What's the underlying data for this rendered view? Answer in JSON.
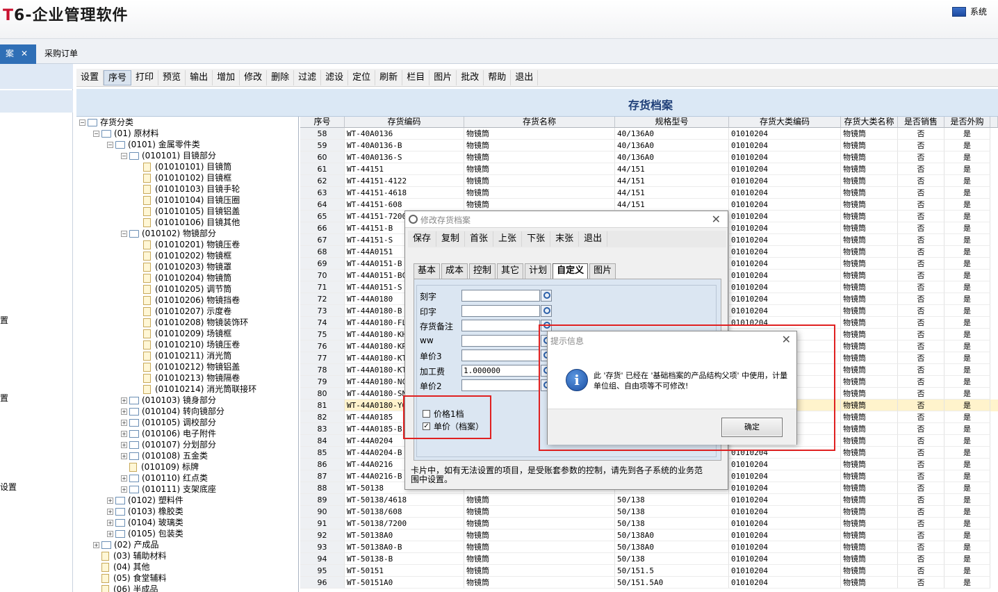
{
  "app": {
    "logo_t": "T",
    "logo_rest": "6-企业管理软件",
    "system_label": "系统"
  },
  "tabs": [
    {
      "label": "案",
      "close": "✕",
      "active": true
    },
    {
      "label": "采购订单",
      "active": false
    }
  ],
  "left_strip": [
    "置",
    "置",
    "设置"
  ],
  "toolbar": [
    "设置",
    "序号",
    "打印",
    "预览",
    "输出",
    "增加",
    "修改",
    "删除",
    "过滤",
    "滤设",
    "定位",
    "刷新",
    "栏目",
    "图片",
    "批改",
    "帮助",
    "退出"
  ],
  "toolbar_pressed": "序号",
  "page_title": "存货档案",
  "tree": [
    {
      "depth": 0,
      "exp": "−",
      "icon": "folder",
      "label": "存货分类"
    },
    {
      "depth": 1,
      "exp": "−",
      "icon": "folder",
      "label": "(01) 原材料"
    },
    {
      "depth": 2,
      "exp": "−",
      "icon": "folder",
      "label": "(0101) 金属零件类"
    },
    {
      "depth": 3,
      "exp": "−",
      "icon": "folder",
      "label": "(010101) 目镜部分"
    },
    {
      "depth": 4,
      "exp": "",
      "icon": "doc",
      "label": "(01010101) 目镜筒"
    },
    {
      "depth": 4,
      "exp": "",
      "icon": "doc",
      "label": "(01010102) 目镜框"
    },
    {
      "depth": 4,
      "exp": "",
      "icon": "doc",
      "label": "(01010103) 目镜手轮"
    },
    {
      "depth": 4,
      "exp": "",
      "icon": "doc",
      "label": "(01010104) 目镜压圈"
    },
    {
      "depth": 4,
      "exp": "",
      "icon": "doc",
      "label": "(01010105) 目镜铝盖"
    },
    {
      "depth": 4,
      "exp": "",
      "icon": "doc",
      "label": "(01010106) 目镜其他"
    },
    {
      "depth": 3,
      "exp": "−",
      "icon": "folder",
      "label": "(010102) 物镜部分"
    },
    {
      "depth": 4,
      "exp": "",
      "icon": "doc",
      "label": "(01010201) 物镜压卷"
    },
    {
      "depth": 4,
      "exp": "",
      "icon": "doc",
      "label": "(01010202) 物镜框"
    },
    {
      "depth": 4,
      "exp": "",
      "icon": "doc",
      "label": "(01010203) 物镜罩"
    },
    {
      "depth": 4,
      "exp": "",
      "icon": "doc",
      "label": "(01010204) 物镜筒"
    },
    {
      "depth": 4,
      "exp": "",
      "icon": "doc",
      "label": "(01010205) 调节筒"
    },
    {
      "depth": 4,
      "exp": "",
      "icon": "doc",
      "label": "(01010206) 物镜挡卷"
    },
    {
      "depth": 4,
      "exp": "",
      "icon": "doc",
      "label": "(01010207) 示度卷"
    },
    {
      "depth": 4,
      "exp": "",
      "icon": "doc",
      "label": "(01010208) 物镜装饰环"
    },
    {
      "depth": 4,
      "exp": "",
      "icon": "doc",
      "label": "(01010209) 场镜框"
    },
    {
      "depth": 4,
      "exp": "",
      "icon": "doc",
      "label": "(01010210) 场镜压卷"
    },
    {
      "depth": 4,
      "exp": "",
      "icon": "doc",
      "label": "(01010211) 消光筒"
    },
    {
      "depth": 4,
      "exp": "",
      "icon": "doc",
      "label": "(01010212) 物镜铝盖"
    },
    {
      "depth": 4,
      "exp": "",
      "icon": "doc",
      "label": "(01010213) 物镜隔卷"
    },
    {
      "depth": 4,
      "exp": "",
      "icon": "doc",
      "label": "(01010214) 消光筒联接环"
    },
    {
      "depth": 3,
      "exp": "+",
      "icon": "folder",
      "label": "(010103) 镜身部分"
    },
    {
      "depth": 3,
      "exp": "+",
      "icon": "folder",
      "label": "(010104) 转向镜部分"
    },
    {
      "depth": 3,
      "exp": "+",
      "icon": "folder",
      "label": "(010105) 调校部分"
    },
    {
      "depth": 3,
      "exp": "+",
      "icon": "folder",
      "label": "(010106) 电子附件"
    },
    {
      "depth": 3,
      "exp": "+",
      "icon": "folder",
      "label": "(010107) 分划部分"
    },
    {
      "depth": 3,
      "exp": "+",
      "icon": "folder",
      "label": "(010108) 五金类"
    },
    {
      "depth": 3,
      "exp": "",
      "icon": "doc",
      "label": "(010109) 标牌"
    },
    {
      "depth": 3,
      "exp": "+",
      "icon": "folder",
      "label": "(010110) 红点类"
    },
    {
      "depth": 3,
      "exp": "+",
      "icon": "folder",
      "label": "(010111) 支架底座"
    },
    {
      "depth": 2,
      "exp": "+",
      "icon": "folder",
      "label": "(0102) 塑料件"
    },
    {
      "depth": 2,
      "exp": "+",
      "icon": "folder",
      "label": "(0103) 橡胶类"
    },
    {
      "depth": 2,
      "exp": "+",
      "icon": "folder",
      "label": "(0104) 玻璃类"
    },
    {
      "depth": 2,
      "exp": "+",
      "icon": "folder",
      "label": "(0105) 包装类"
    },
    {
      "depth": 1,
      "exp": "+",
      "icon": "folder",
      "label": "(02) 产成品"
    },
    {
      "depth": 1,
      "exp": "",
      "icon": "doc",
      "label": "(03) 辅助材料"
    },
    {
      "depth": 1,
      "exp": "",
      "icon": "doc",
      "label": "(04) 其他"
    },
    {
      "depth": 1,
      "exp": "",
      "icon": "doc",
      "label": "(05) 食堂辅料"
    },
    {
      "depth": 1,
      "exp": "",
      "icon": "doc",
      "label": "(06) 半成品"
    }
  ],
  "grid": {
    "columns": [
      "序号",
      "存货编码",
      "存货名称",
      "规格型号",
      "存货大类编码",
      "存货大类名称",
      "是否销售",
      "是否外购"
    ],
    "rows": [
      [
        "58",
        "WT-40A0136",
        "物镜筒",
        "40/136A0",
        "01010204",
        "物镜筒",
        "否",
        "是"
      ],
      [
        "59",
        "WT-40A0136-B",
        "物镜筒",
        "40/136A0",
        "01010204",
        "物镜筒",
        "否",
        "是"
      ],
      [
        "60",
        "WT-40A0136-S",
        "物镜筒",
        "40/136A0",
        "01010204",
        "物镜筒",
        "否",
        "是"
      ],
      [
        "61",
        "WT-44151",
        "物镜筒",
        "44/151",
        "01010204",
        "物镜筒",
        "否",
        "是"
      ],
      [
        "62",
        "WT-44151-4122",
        "物镜筒",
        "44/151",
        "01010204",
        "物镜筒",
        "否",
        "是"
      ],
      [
        "63",
        "WT-44151-4618",
        "物镜筒",
        "44/151",
        "01010204",
        "物镜筒",
        "否",
        "是"
      ],
      [
        "64",
        "WT-44151-608",
        "物镜筒",
        "44/151",
        "01010204",
        "物镜筒",
        "否",
        "是"
      ],
      [
        "65",
        "WT-44151-7200",
        "",
        "",
        "01010204",
        "物镜筒",
        "否",
        "是"
      ],
      [
        "66",
        "WT-44151-B",
        "",
        "",
        "01010204",
        "物镜筒",
        "否",
        "是"
      ],
      [
        "67",
        "WT-44151-S",
        "",
        "",
        "01010204",
        "物镜筒",
        "否",
        "是"
      ],
      [
        "68",
        "WT-44A0151",
        "",
        "",
        "01010204",
        "物镜筒",
        "否",
        "是"
      ],
      [
        "69",
        "WT-44A0151-B",
        "",
        "",
        "01010204",
        "物镜筒",
        "否",
        "是"
      ],
      [
        "70",
        "WT-44A0151-BC",
        "",
        "",
        "01010204",
        "物镜筒",
        "否",
        "是"
      ],
      [
        "71",
        "WT-44A0151-S",
        "",
        "",
        "01010204",
        "物镜筒",
        "否",
        "是"
      ],
      [
        "72",
        "WT-44A0180",
        "",
        "",
        "01010204",
        "物镜筒",
        "否",
        "是"
      ],
      [
        "73",
        "WT-44A0180-B",
        "",
        "",
        "01010204",
        "物镜筒",
        "否",
        "是"
      ],
      [
        "74",
        "WT-44A0180-FL",
        "",
        "",
        "01010204",
        "物镜筒",
        "否",
        "是"
      ],
      [
        "75",
        "WT-44A0180-KH",
        "",
        "",
        "",
        "物镜筒",
        "否",
        "是"
      ],
      [
        "76",
        "WT-44A0180-KR",
        "",
        "",
        "",
        "物镜筒",
        "否",
        "是"
      ],
      [
        "77",
        "WT-44A0180-KT",
        "",
        "",
        "",
        "物镜筒",
        "否",
        "是"
      ],
      [
        "78",
        "WT-44A0180-KT",
        "",
        "",
        "",
        "物镜筒",
        "否",
        "是"
      ],
      [
        "79",
        "WT-44A0180-NC",
        "",
        "",
        "",
        "物镜筒",
        "否",
        "是"
      ],
      [
        "80",
        "WT-44A0180-SN",
        "",
        "",
        "",
        "物镜筒",
        "否",
        "是"
      ],
      [
        "81",
        "WT-44A0180-YO",
        "",
        "",
        "",
        "物镜筒",
        "否",
        "是"
      ],
      [
        "82",
        "WT-44A0185",
        "",
        "",
        "",
        "物镜筒",
        "否",
        "是"
      ],
      [
        "83",
        "WT-44A0185-B",
        "",
        "",
        "",
        "物镜筒",
        "否",
        "是"
      ],
      [
        "84",
        "WT-44A0204",
        "",
        "",
        "",
        "物镜筒",
        "否",
        "是"
      ],
      [
        "85",
        "WT-44A0204-B",
        "",
        "",
        "01010204",
        "物镜筒",
        "否",
        "是"
      ],
      [
        "86",
        "WT-44A0216",
        "",
        "",
        "01010204",
        "物镜筒",
        "否",
        "是"
      ],
      [
        "87",
        "WT-44A0216-B",
        "",
        "",
        "01010204",
        "物镜筒",
        "否",
        "是"
      ],
      [
        "88",
        "WT-50138",
        "",
        "",
        "01010204",
        "物镜筒",
        "否",
        "是"
      ],
      [
        "89",
        "WT-50138/4618",
        "物镜筒",
        "50/138",
        "01010204",
        "物镜筒",
        "否",
        "是"
      ],
      [
        "90",
        "WT-50138/608",
        "物镜筒",
        "50/138",
        "01010204",
        "物镜筒",
        "否",
        "是"
      ],
      [
        "91",
        "WT-50138/7200",
        "物镜筒",
        "50/138",
        "01010204",
        "物镜筒",
        "否",
        "是"
      ],
      [
        "92",
        "WT-50138A0",
        "物镜筒",
        "50/138A0",
        "01010204",
        "物镜筒",
        "否",
        "是"
      ],
      [
        "93",
        "WT-50138A0-B",
        "物镜筒",
        "50/138A0",
        "01010204",
        "物镜筒",
        "否",
        "是"
      ],
      [
        "94",
        "WT-50138-B",
        "物镜筒",
        "50/138",
        "01010204",
        "物镜筒",
        "否",
        "是"
      ],
      [
        "95",
        "WT-50151",
        "物镜筒",
        "50/151.5",
        "01010204",
        "物镜筒",
        "否",
        "是"
      ],
      [
        "96",
        "WT-50151A0",
        "物镜筒",
        "50/151.5A0",
        "01010204",
        "物镜筒",
        "否",
        "是"
      ]
    ],
    "selected_row": "81"
  },
  "modify_dialog": {
    "title": "修改存货档案",
    "toolbar": [
      "保存",
      "复制",
      "首张",
      "上张",
      "下张",
      "末张",
      "退出"
    ],
    "tabs": [
      "基本",
      "成本",
      "控制",
      "其它",
      "计划",
      "自定义",
      "图片"
    ],
    "active_tab": "自定义",
    "fields": [
      {
        "label": "刻字",
        "value": ""
      },
      {
        "label": "印字",
        "value": ""
      },
      {
        "label": "存货备注",
        "value": ""
      },
      {
        "label": "ww",
        "value": ""
      },
      {
        "label": "单价3",
        "value": ""
      },
      {
        "label": "加工费",
        "value": "1.000000"
      },
      {
        "label": "单价2",
        "value": ""
      }
    ],
    "checkboxes": [
      {
        "label": "价格1档",
        "checked": false
      },
      {
        "label": "单价（档案）",
        "checked": true
      }
    ],
    "note": "卡片中，如有无法设置的项目，是受账套参数的控制，请先到各子系统的业务范围中设置。"
  },
  "info_dialog": {
    "title": "提示信息",
    "message": "此 '存货' 已经在 '基础档案的产品结构父项' 中使用，计量单位组、自由项等不可修改!",
    "ok": "确定"
  },
  "colors": {
    "accent": "#2f6fb6",
    "header_band": "#dbe8f5",
    "highlight": "#e02020",
    "selected_row": "#fff3cc"
  }
}
